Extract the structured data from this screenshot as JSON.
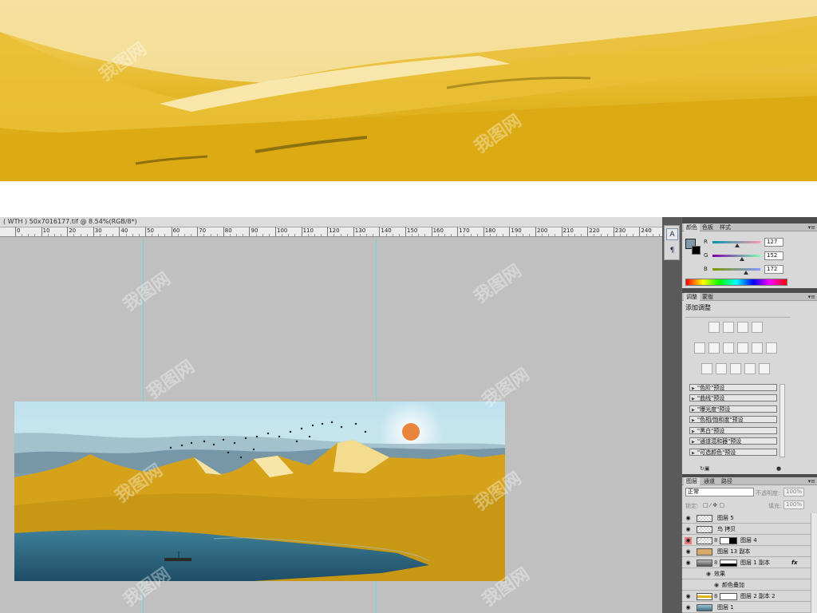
{
  "document": {
    "title": "( WTH ) 50x7016177.tif @ 8.54%(RGB/8*)",
    "ruler_ticks": [
      "0",
      "10",
      "20",
      "30",
      "40",
      "50",
      "60",
      "70",
      "80",
      "90",
      "100",
      "110",
      "120",
      "130",
      "140",
      "150",
      "160",
      "170",
      "180",
      "190",
      "200",
      "210",
      "220",
      "230",
      "240"
    ]
  },
  "color_panel": {
    "tabs": [
      "颜色",
      "色板",
      "样式"
    ],
    "r_label": "R",
    "g_label": "G",
    "b_label": "B",
    "r_value": "127",
    "g_value": "152",
    "b_value": "172",
    "foreground_color": "#7f98ac"
  },
  "adjustments_panel": {
    "tabs": [
      "调整",
      "蒙版"
    ],
    "heading": "添加调整",
    "presets": [
      "\"色阶\"预设",
      "\"曲线\"预设",
      "\"曝光度\"预设",
      "\"色相/饱和度\"预设",
      "\"黑白\"预设",
      "\"通道混和器\"预设",
      "\"可选颜色\"预设"
    ]
  },
  "layers_panel": {
    "tabs": [
      "图层",
      "通道",
      "路径"
    ],
    "blend_mode": "正常",
    "opacity_label": "不透明度:",
    "opacity_value": "100%",
    "lock_label": "锁定:",
    "fill_label": "填充:",
    "fill_value": "100%",
    "layers": [
      {
        "name": "图层 5"
      },
      {
        "name": "鸟 拷贝"
      },
      {
        "name": "图层 4"
      },
      {
        "name": "图层 13 副本"
      },
      {
        "name": "图层 1 副本",
        "fx": "fx"
      },
      {
        "name": "效果"
      },
      {
        "name": "颜色叠加"
      },
      {
        "name": "图层 2 副本 2"
      },
      {
        "name": "图层 1"
      }
    ]
  },
  "watermark_text": "我图网"
}
